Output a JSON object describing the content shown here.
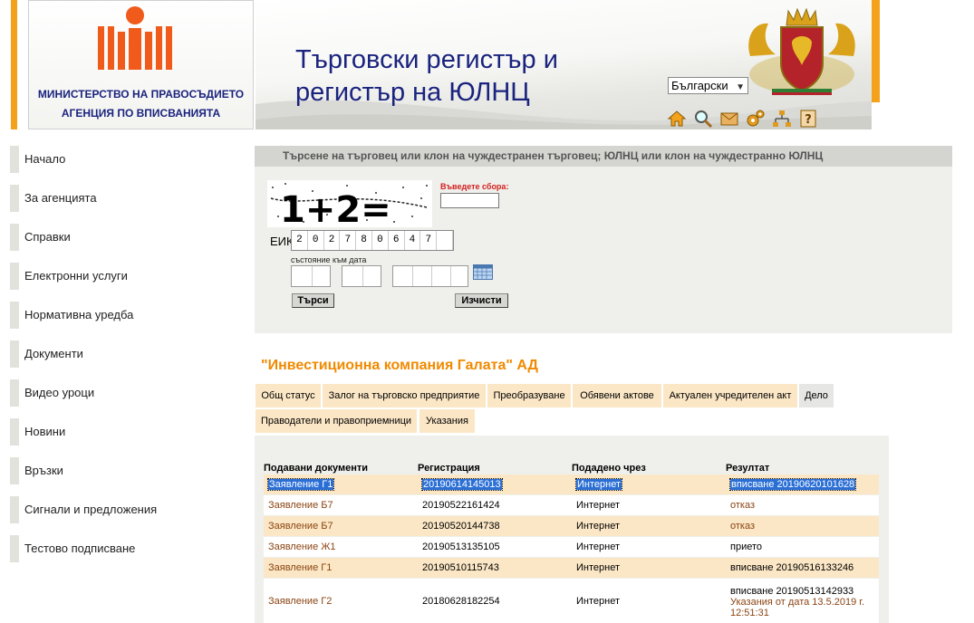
{
  "header": {
    "org_line1": "МИНИСТЕРСТВО НА ПРАВОСЪДИЕТО",
    "org_line2": "АГЕНЦИЯ ПО ВПИСВАНИЯТА",
    "registry_title": "Търговски регистър и регистър на ЮЛНЦ",
    "language": "Български",
    "icons": [
      "home-icon",
      "search-icon",
      "mail-icon",
      "settings-icon",
      "sitemap-icon",
      "help-icon"
    ],
    "accent_color": "#f4a21c",
    "title_color": "#1a237e"
  },
  "sidebar": {
    "items": [
      {
        "label": "Начало"
      },
      {
        "label": "За агенцията"
      },
      {
        "label": "Справки"
      },
      {
        "label": "Електронни услуги"
      },
      {
        "label": "Нормативна уредба"
      },
      {
        "label": "Документи"
      },
      {
        "label": "Видео уроци"
      },
      {
        "label": "Новини"
      },
      {
        "label": "Връзки"
      },
      {
        "label": "Сигнали и предложения"
      },
      {
        "label": "Тестово подписване"
      }
    ]
  },
  "search": {
    "heading": "Търсене на търговец или клон на чуждестранен търговец; ЮЛНЦ или клон на чуждестранно ЮЛНЦ",
    "captcha_label": "Въведете сбора:",
    "captcha_text": "1+2=",
    "eik_label": "ЕИК:",
    "eik_digits": [
      "2",
      "0",
      "2",
      "7",
      "8",
      "0",
      "6",
      "4",
      "7",
      "",
      ""
    ],
    "state_label": "състояние към дата",
    "search_button": "Търси",
    "clear_button": "Изчисти"
  },
  "company": {
    "name": "\"Инвестиционна компания Галата\" АД",
    "tabs": [
      {
        "label": "Общ статус"
      },
      {
        "label": "Залог на търговско предприятие"
      },
      {
        "label": "Преобразуване"
      },
      {
        "label": "Обявени актове"
      },
      {
        "label": "Актуален учредителен акт"
      },
      {
        "label": "Дело"
      },
      {
        "label": "Праводатели и правоприемници"
      },
      {
        "label": "Указания"
      }
    ],
    "active_tab": "Дело"
  },
  "documents": {
    "headers": [
      "Подавани документи",
      "Регистрация",
      "Подадено чрез",
      "Резултат"
    ],
    "rows": [
      {
        "doc": "Заявление Г1",
        "reg": "20190614145013",
        "via": "Интернет",
        "result": "вписване 20190620101628",
        "selected": true
      },
      {
        "doc": "Заявление Б7",
        "reg": "20190522161424",
        "via": "Интернет",
        "result": "отказ"
      },
      {
        "doc": "Заявление Б7",
        "reg": "20190520144738",
        "via": "Интернет",
        "result": "отказ"
      },
      {
        "doc": "Заявление Ж1",
        "reg": "20190513135105",
        "via": "Интернет",
        "result": "прието"
      },
      {
        "doc": "Заявление Г1",
        "reg": "20190510115743",
        "via": "Интернет",
        "result": "вписване 20190516133246"
      },
      {
        "doc": "Заявление Г2",
        "reg": "20180628182254",
        "via": "Интернет",
        "result_lines": [
          "вписване 20190513142933",
          "Указания от дата 13.5.2019 г.",
          "12:51:31"
        ]
      }
    ]
  }
}
